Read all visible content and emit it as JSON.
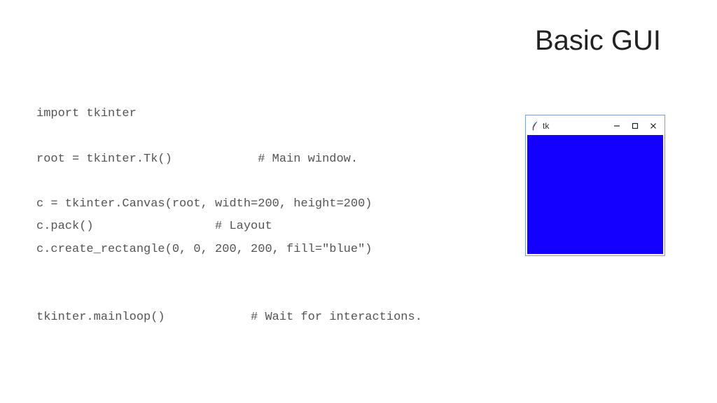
{
  "slide": {
    "title": "Basic GUI"
  },
  "code": {
    "lines": [
      "import tkinter",
      "",
      "root = tkinter.Tk()            # Main window.",
      "",
      "c = tkinter.Canvas(root, width=200, height=200)",
      "c.pack()                 # Layout",
      "c.create_rectangle(0, 0, 200, 200, fill=\"blue\")",
      "",
      "",
      "tkinter.mainloop()            # Wait for interactions."
    ]
  },
  "mock_window": {
    "title": "tk",
    "canvas_fill": "#1400ff"
  }
}
